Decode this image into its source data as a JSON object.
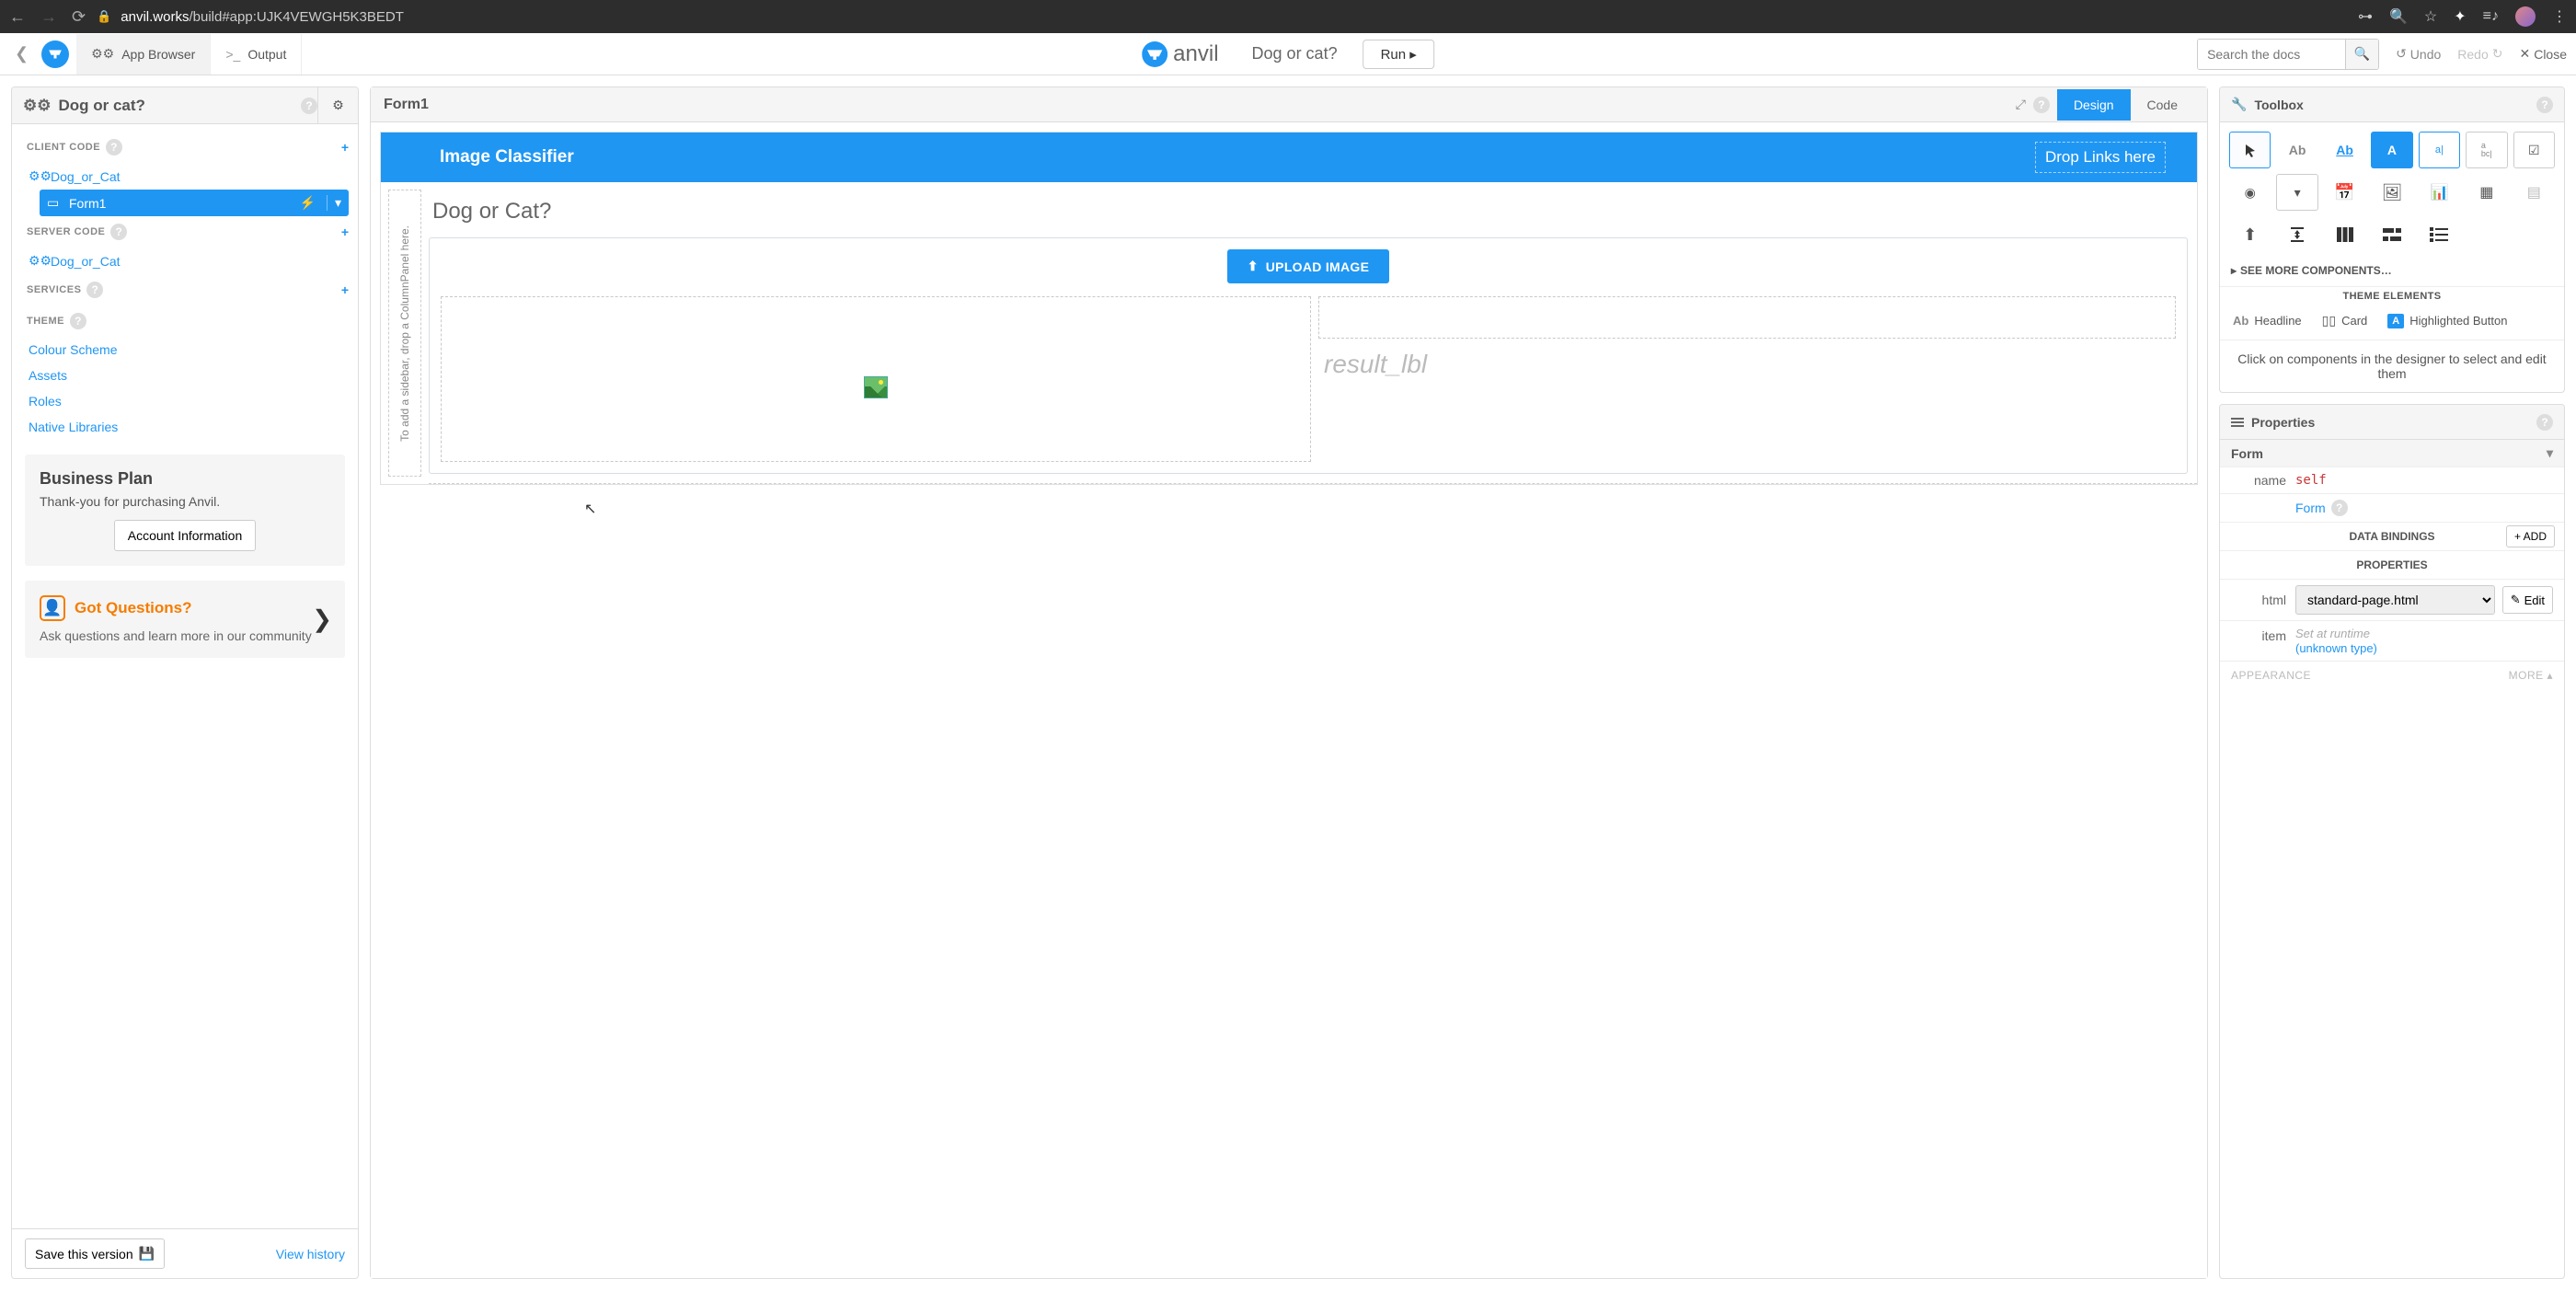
{
  "browser": {
    "host": "anvil.works",
    "path": "/build#app:UJK4VEWGH5K3BEDT"
  },
  "header": {
    "app_browser": "App Browser",
    "output": "Output",
    "brand": "anvil",
    "app_name": "Dog or cat?",
    "run": "Run",
    "search_placeholder": "Search the docs",
    "undo": "Undo",
    "redo": "Redo",
    "close": "Close"
  },
  "left": {
    "app_title": "Dog or cat?",
    "client_code": "CLIENT CODE",
    "server_code": "SERVER CODE",
    "services": "SERVICES",
    "theme": "THEME",
    "module_client": "Dog_or_Cat",
    "form1": "Form1",
    "module_server": "Dog_or_Cat",
    "theme_links": {
      "colour": "Colour Scheme",
      "assets": "Assets",
      "roles": "Roles",
      "native": "Native Libraries"
    },
    "plan": {
      "title": "Business Plan",
      "desc": "Thank-you for purchasing Anvil.",
      "button": "Account Information"
    },
    "promo": {
      "title": "Got Questions?",
      "desc": "Ask questions and learn more in our community"
    },
    "save": "Save this version",
    "history": "View history"
  },
  "center": {
    "form_title": "Form1",
    "tab_design": "Design",
    "tab_code": "Code",
    "titlebar": "Image Classifier",
    "drop_links": "Drop Links here",
    "sidebar_hint": "To add a sidebar, drop a ColumnPanel here.",
    "heading": "Dog or Cat?",
    "upload": "UPLOAD IMAGE",
    "result_lbl": "result_lbl"
  },
  "right": {
    "toolbox": "Toolbox",
    "see_more": "SEE MORE COMPONENTS…",
    "theme_elements": "THEME ELEMENTS",
    "theme_items": {
      "headline": "Headline",
      "card": "Card",
      "highlighted": "Highlighted Button"
    },
    "hint": "Click on components in the designer to select and edit them",
    "properties": "Properties",
    "form_section": "Form",
    "name_label": "name",
    "name_value": "self",
    "form_link": "Form",
    "data_bindings": "DATA BINDINGS",
    "add": "ADD",
    "props_hdr": "PROPERTIES",
    "html_label": "html",
    "html_value": "standard-page.html",
    "edit": "Edit",
    "item_label": "item",
    "item_runtime": "Set at runtime",
    "item_type": "(unknown type)",
    "appearance": "APPEARANCE",
    "more": "MORE"
  }
}
